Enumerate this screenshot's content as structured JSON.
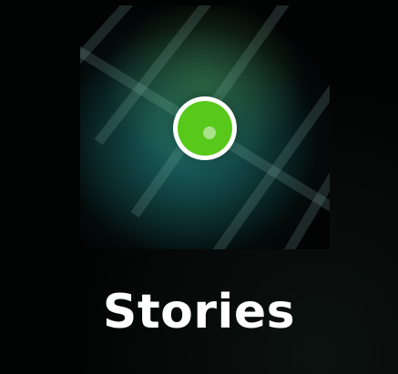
{
  "app": {
    "label": "Stories",
    "icon": "map-location-pin-icon",
    "colors": {
      "background": "#020403",
      "tile_center": "#1d6b67",
      "pin_fill": "#58c91a",
      "pin_ring": "#ffffff",
      "label_text": "#ffffff"
    }
  }
}
